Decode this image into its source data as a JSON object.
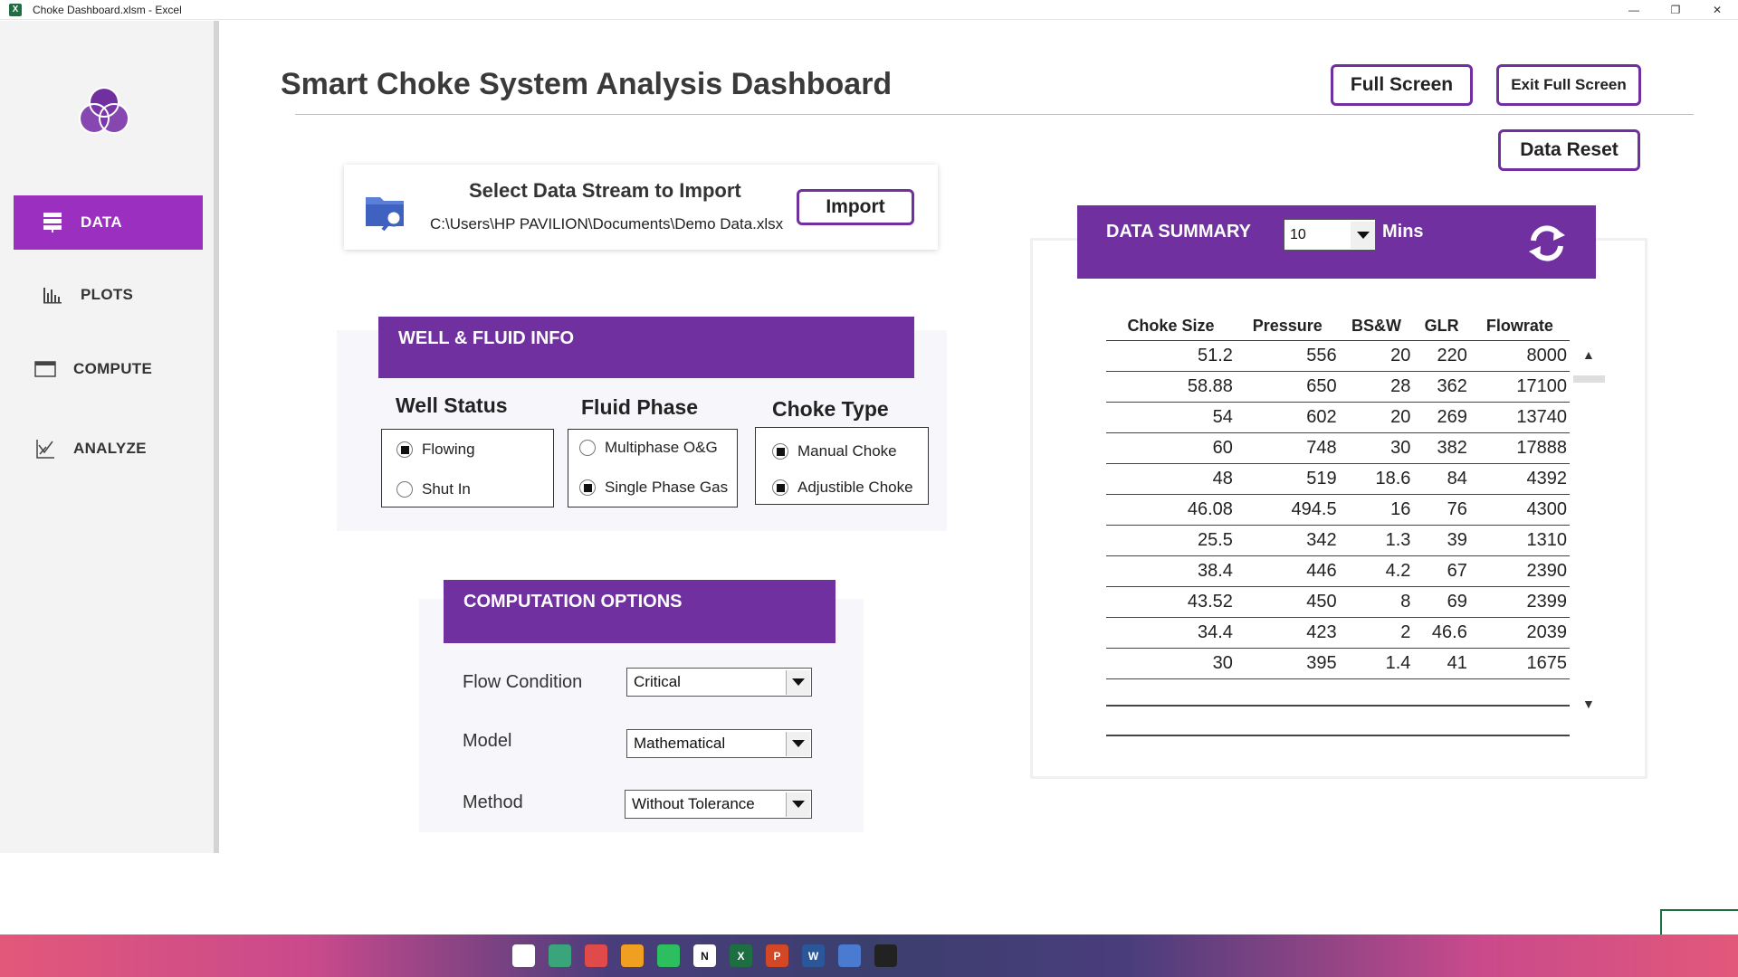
{
  "window": {
    "title": "Choke Dashboard.xlsm - Excel",
    "app_badge": "X",
    "controls": [
      "—",
      "❐",
      "✕"
    ]
  },
  "sidebar": {
    "items": [
      {
        "label": "DATA",
        "icon": "database-icon",
        "active": true
      },
      {
        "label": "PLOTS",
        "icon": "bar-chart-icon",
        "active": false
      },
      {
        "label": "COMPUTE",
        "icon": "window-icon",
        "active": false
      },
      {
        "label": "ANALYZE",
        "icon": "analyze-chart-icon",
        "active": false
      }
    ]
  },
  "header": {
    "title": "Smart Choke System Analysis Dashboard",
    "full_screen": "Full Screen",
    "exit_full_screen": "Exit Full Screen",
    "data_reset": "Data Reset"
  },
  "import_panel": {
    "title": "Select Data Stream to Import",
    "path": "C:\\Users\\HP PAVILION\\Documents\\Demo Data.xlsx",
    "button": "Import"
  },
  "well_fluid": {
    "heading": "WELL & FLUID INFO",
    "well_status": {
      "label": "Well Status",
      "options": [
        "Flowing",
        "Shut In"
      ],
      "selected": [
        "Flowing"
      ]
    },
    "fluid_phase": {
      "label": "Fluid Phase",
      "options": [
        "Multiphase O&G",
        "Single Phase Gas"
      ],
      "selected": [
        "Single Phase Gas"
      ]
    },
    "choke_type": {
      "label": "Choke Type",
      "options": [
        "Manual Choke",
        "Adjustible Choke"
      ],
      "selected": [
        "Manual Choke",
        "Adjustible Choke"
      ]
    }
  },
  "computation": {
    "heading": "COMPUTATION OPTIONS",
    "flow_condition": {
      "label": "Flow Condition",
      "value": "Critical"
    },
    "model": {
      "label": "Model",
      "value": "Mathematical"
    },
    "method": {
      "label": "Method",
      "value": "Without Tolerance"
    }
  },
  "summary": {
    "heading": "DATA SUMMARY",
    "interval": "10",
    "unit": "Mins",
    "columns": [
      "Choke Size",
      "Pressure",
      "BS&W",
      "GLR",
      "Flowrate"
    ],
    "rows": [
      [
        "51.2",
        "556",
        "20",
        "220",
        "8000"
      ],
      [
        "58.88",
        "650",
        "28",
        "362",
        "17100"
      ],
      [
        "54",
        "602",
        "20",
        "269",
        "13740"
      ],
      [
        "60",
        "748",
        "30",
        "382",
        "17888"
      ],
      [
        "48",
        "519",
        "18.6",
        "84",
        "4392"
      ],
      [
        "46.08",
        "494.5",
        "16",
        "76",
        "4300"
      ],
      [
        "25.5",
        "342",
        "1.3",
        "39",
        "1310"
      ],
      [
        "38.4",
        "446",
        "4.2",
        "67",
        "2390"
      ],
      [
        "43.52",
        "450",
        "8",
        "69",
        "2399"
      ],
      [
        "34.4",
        "423",
        "2",
        "46.6",
        "2039"
      ],
      [
        "30",
        "395",
        "1.4",
        "41",
        "1675"
      ]
    ]
  },
  "taskbar": {
    "apps": [
      {
        "name": "start-icon",
        "color": "#ffffff"
      },
      {
        "name": "app-icon",
        "color": "#3aa57a"
      },
      {
        "name": "record-icon",
        "color": "#e04a4a"
      },
      {
        "name": "apps-icon",
        "color": "#f0a020"
      },
      {
        "name": "evernote-icon",
        "color": "#2dbe60"
      },
      {
        "name": "notion-icon",
        "color": "#ffffff",
        "glyph": "N"
      },
      {
        "name": "excel-icon",
        "color": "#1d6f42",
        "glyph": "X"
      },
      {
        "name": "powerpoint-icon",
        "color": "#d24726",
        "glyph": "P"
      },
      {
        "name": "word-icon",
        "color": "#2b579a",
        "glyph": "W"
      },
      {
        "name": "todo-icon",
        "color": "#4a7bd0"
      },
      {
        "name": "calculator-icon",
        "color": "#222222"
      }
    ]
  }
}
